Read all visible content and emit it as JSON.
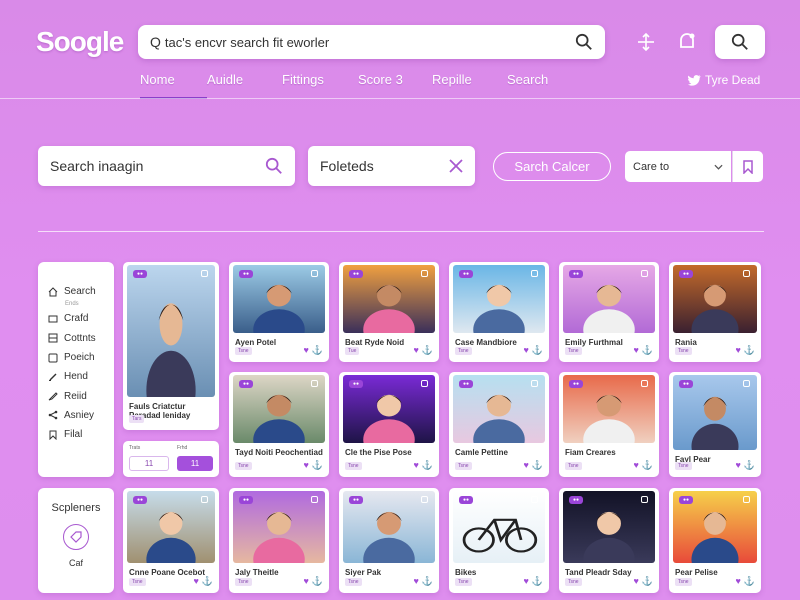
{
  "header": {
    "logo": "Soogle",
    "search_value": "tac's encvr search fit eworler",
    "tweet_label": "Tyre Dead"
  },
  "nav": [
    {
      "label": "Nome",
      "active": true
    },
    {
      "label": "Auidle"
    },
    {
      "label": "Fittings"
    },
    {
      "label": "Score 3"
    },
    {
      "label": "Repille"
    },
    {
      "label": "Search"
    }
  ],
  "filters": {
    "search_placeholder": "Search inaagin",
    "folder_value": "Foleteds",
    "pill_label": "Sarch Calcer",
    "select_value": "Care to"
  },
  "sidebar": {
    "items": [
      {
        "label": "Search",
        "icon": "home-icon",
        "sub": "Ends"
      },
      {
        "label": "Crafd",
        "icon": "image-icon"
      },
      {
        "label": "Cottnts",
        "icon": "grid-icon"
      },
      {
        "label": "Poeich",
        "icon": "box-icon"
      },
      {
        "label": "Hend",
        "icon": "edit-icon"
      },
      {
        "label": "Reiid",
        "icon": "pen-icon"
      },
      {
        "label": "Asniey",
        "icon": "share-icon"
      },
      {
        "label": "Filal",
        "icon": "bookmark-icon"
      }
    ],
    "bottom_title": "Scpleners",
    "bottom_label": "Caf"
  },
  "mini_panel": {
    "label1": "Trats",
    "label2": "Frhd",
    "value1": "11",
    "value2": "11"
  },
  "cards": [
    {
      "title": "Fauls Criatctur Paradad leniday",
      "title2": "Paradad leniday",
      "tag": "Tars"
    },
    {
      "title": "Ayen Potel",
      "tag": "Tsne"
    },
    {
      "title": "Beat Ryde Noid",
      "tag": "Tue"
    },
    {
      "title": "Case Mandbiore",
      "tag": "Tsne"
    },
    {
      "title": "Emily Furthmal",
      "tag": "Tsne"
    },
    {
      "title": "Rania",
      "tag": "Tsne"
    },
    {
      "title": "Tayd Noiti Peochentiad",
      "tag": "Tsne"
    },
    {
      "title": "Cle the Pise Pose",
      "tag": "Tsne"
    },
    {
      "title": "Camle Pettine",
      "tag": "Tsne"
    },
    {
      "title": "Fiam Creares",
      "tag": "Tsne"
    },
    {
      "title": "Fayl Pear",
      "tag": "Tsne"
    },
    {
      "title": "Cnne Poane Ocebot",
      "tag": "Tsne"
    },
    {
      "title": "Jaly Theitle",
      "tag": "Tsne"
    },
    {
      "title": "Siyer Pak",
      "tag": "Tsne"
    },
    {
      "title": "Bikes",
      "tag": "Tsne"
    },
    {
      "title": "Tand Pleadr Sday",
      "tag": "Tsne"
    },
    {
      "title": "Pear Pelise",
      "tag": "Tsne"
    }
  ],
  "colors": {
    "accent": "#9a45d8",
    "background": "#de8eee"
  }
}
